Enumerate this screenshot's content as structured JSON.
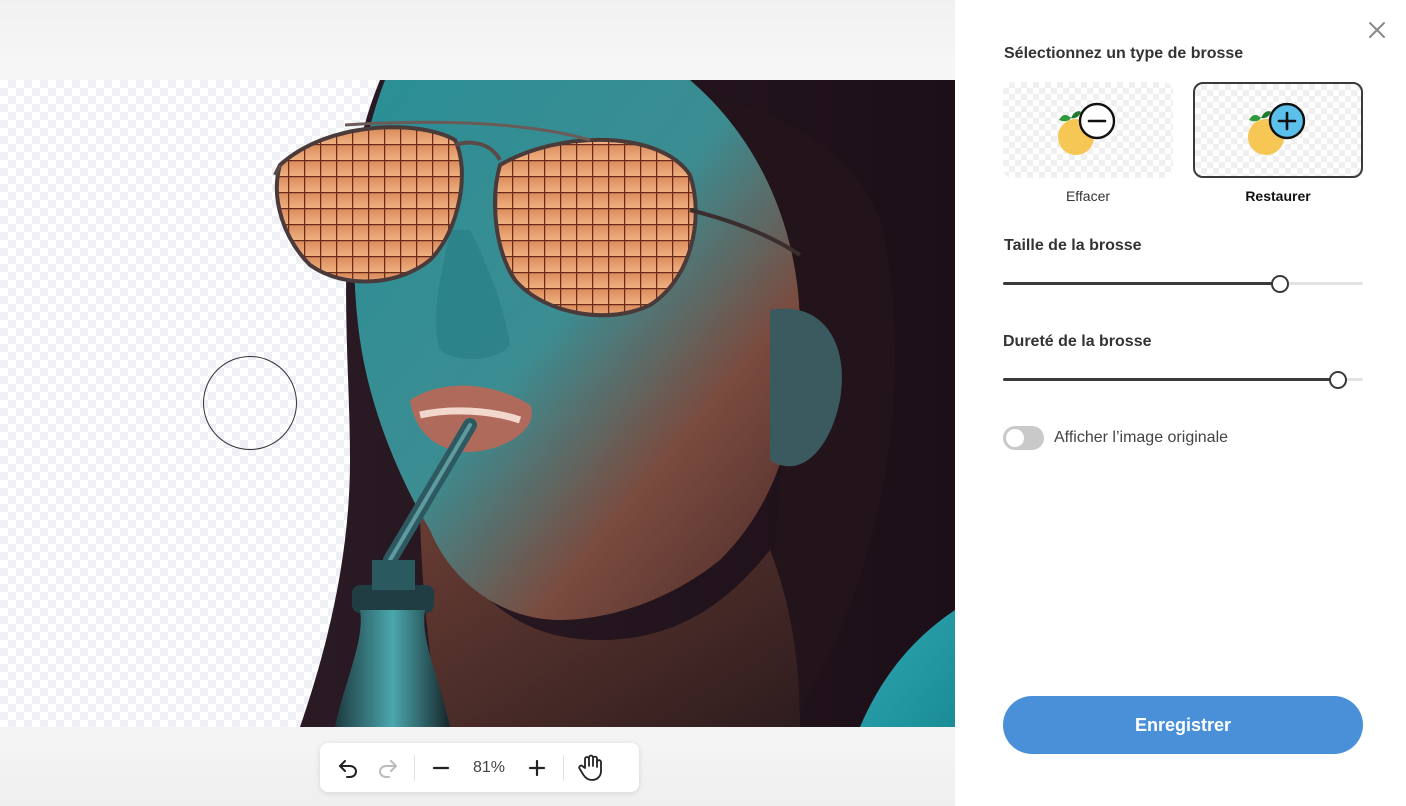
{
  "canvas": {
    "zoom_label": "81%",
    "icons": {
      "undo": "undo-icon",
      "redo": "redo-icon",
      "zoom_out": "minus-icon",
      "zoom_in": "plus-icon",
      "pan": "hand-icon"
    }
  },
  "panel": {
    "brush_type_title": "Sélectionnez un type de brosse",
    "brushes": [
      {
        "label": "Effacer",
        "icon": "erase-brush-icon",
        "selected": false
      },
      {
        "label": "Restaurer",
        "icon": "restore-brush-icon",
        "selected": true
      }
    ],
    "size_title": "Taille de la brosse",
    "size_value": 0.77,
    "hardness_title": "Dureté de la brosse",
    "hardness_value": 0.93,
    "toggle_label": "Afficher l’image originale",
    "toggle_on": false,
    "save_label": "Enregistrer",
    "close_icon": "close-icon"
  },
  "colors": {
    "accent": "#4a90d9",
    "restore_badge": "#5bc0eb",
    "dark": "#3a3a3a"
  }
}
